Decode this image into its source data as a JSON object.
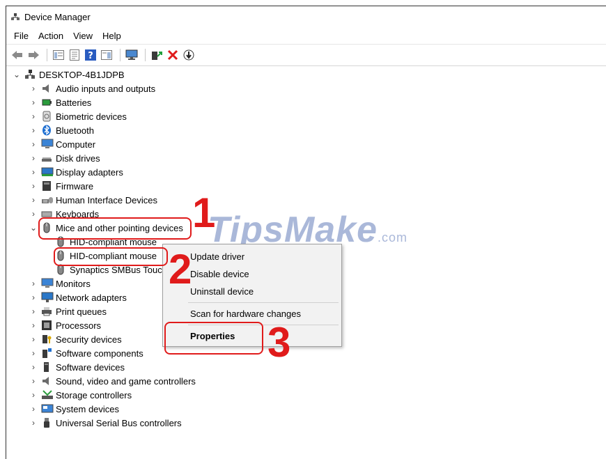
{
  "window": {
    "title": "Device Manager"
  },
  "menubar": {
    "items": [
      "File",
      "Action",
      "View",
      "Help"
    ]
  },
  "toolbar": {
    "icons": [
      "back-icon",
      "forward-icon",
      "console-tree-icon",
      "properties-icon",
      "help-icon",
      "action-pane-icon",
      "display-icon",
      "update-driver-icon",
      "uninstall-icon",
      "enable-device-icon"
    ]
  },
  "tree": {
    "root": "DESKTOP-4B1JDPB",
    "categories": [
      "Audio inputs and outputs",
      "Batteries",
      "Biometric devices",
      "Bluetooth",
      "Computer",
      "Disk drives",
      "Display adapters",
      "Firmware",
      "Human Interface Devices",
      "Keyboards",
      "Mice and other pointing devices",
      "Monitors",
      "Network adapters",
      "Print queues",
      "Processors",
      "Security devices",
      "Software components",
      "Software devices",
      "Sound, video and game controllers",
      "Storage controllers",
      "System devices",
      "Universal Serial Bus controllers"
    ],
    "mice_children": [
      "HID-compliant mouse",
      "HID-compliant mouse",
      "Synaptics SMBus Touc"
    ]
  },
  "context_menu": {
    "items": [
      "Update driver",
      "Disable device",
      "Uninstall device",
      "Scan for hardware changes",
      "Properties"
    ]
  },
  "annotations": {
    "step1": "1",
    "step2": "2",
    "step3": "3"
  },
  "watermark": {
    "text": "TipsMake",
    "suffix": ".com"
  },
  "colors": {
    "annotation": "#e01b1b",
    "bluetooth": "#1e6fd1"
  }
}
